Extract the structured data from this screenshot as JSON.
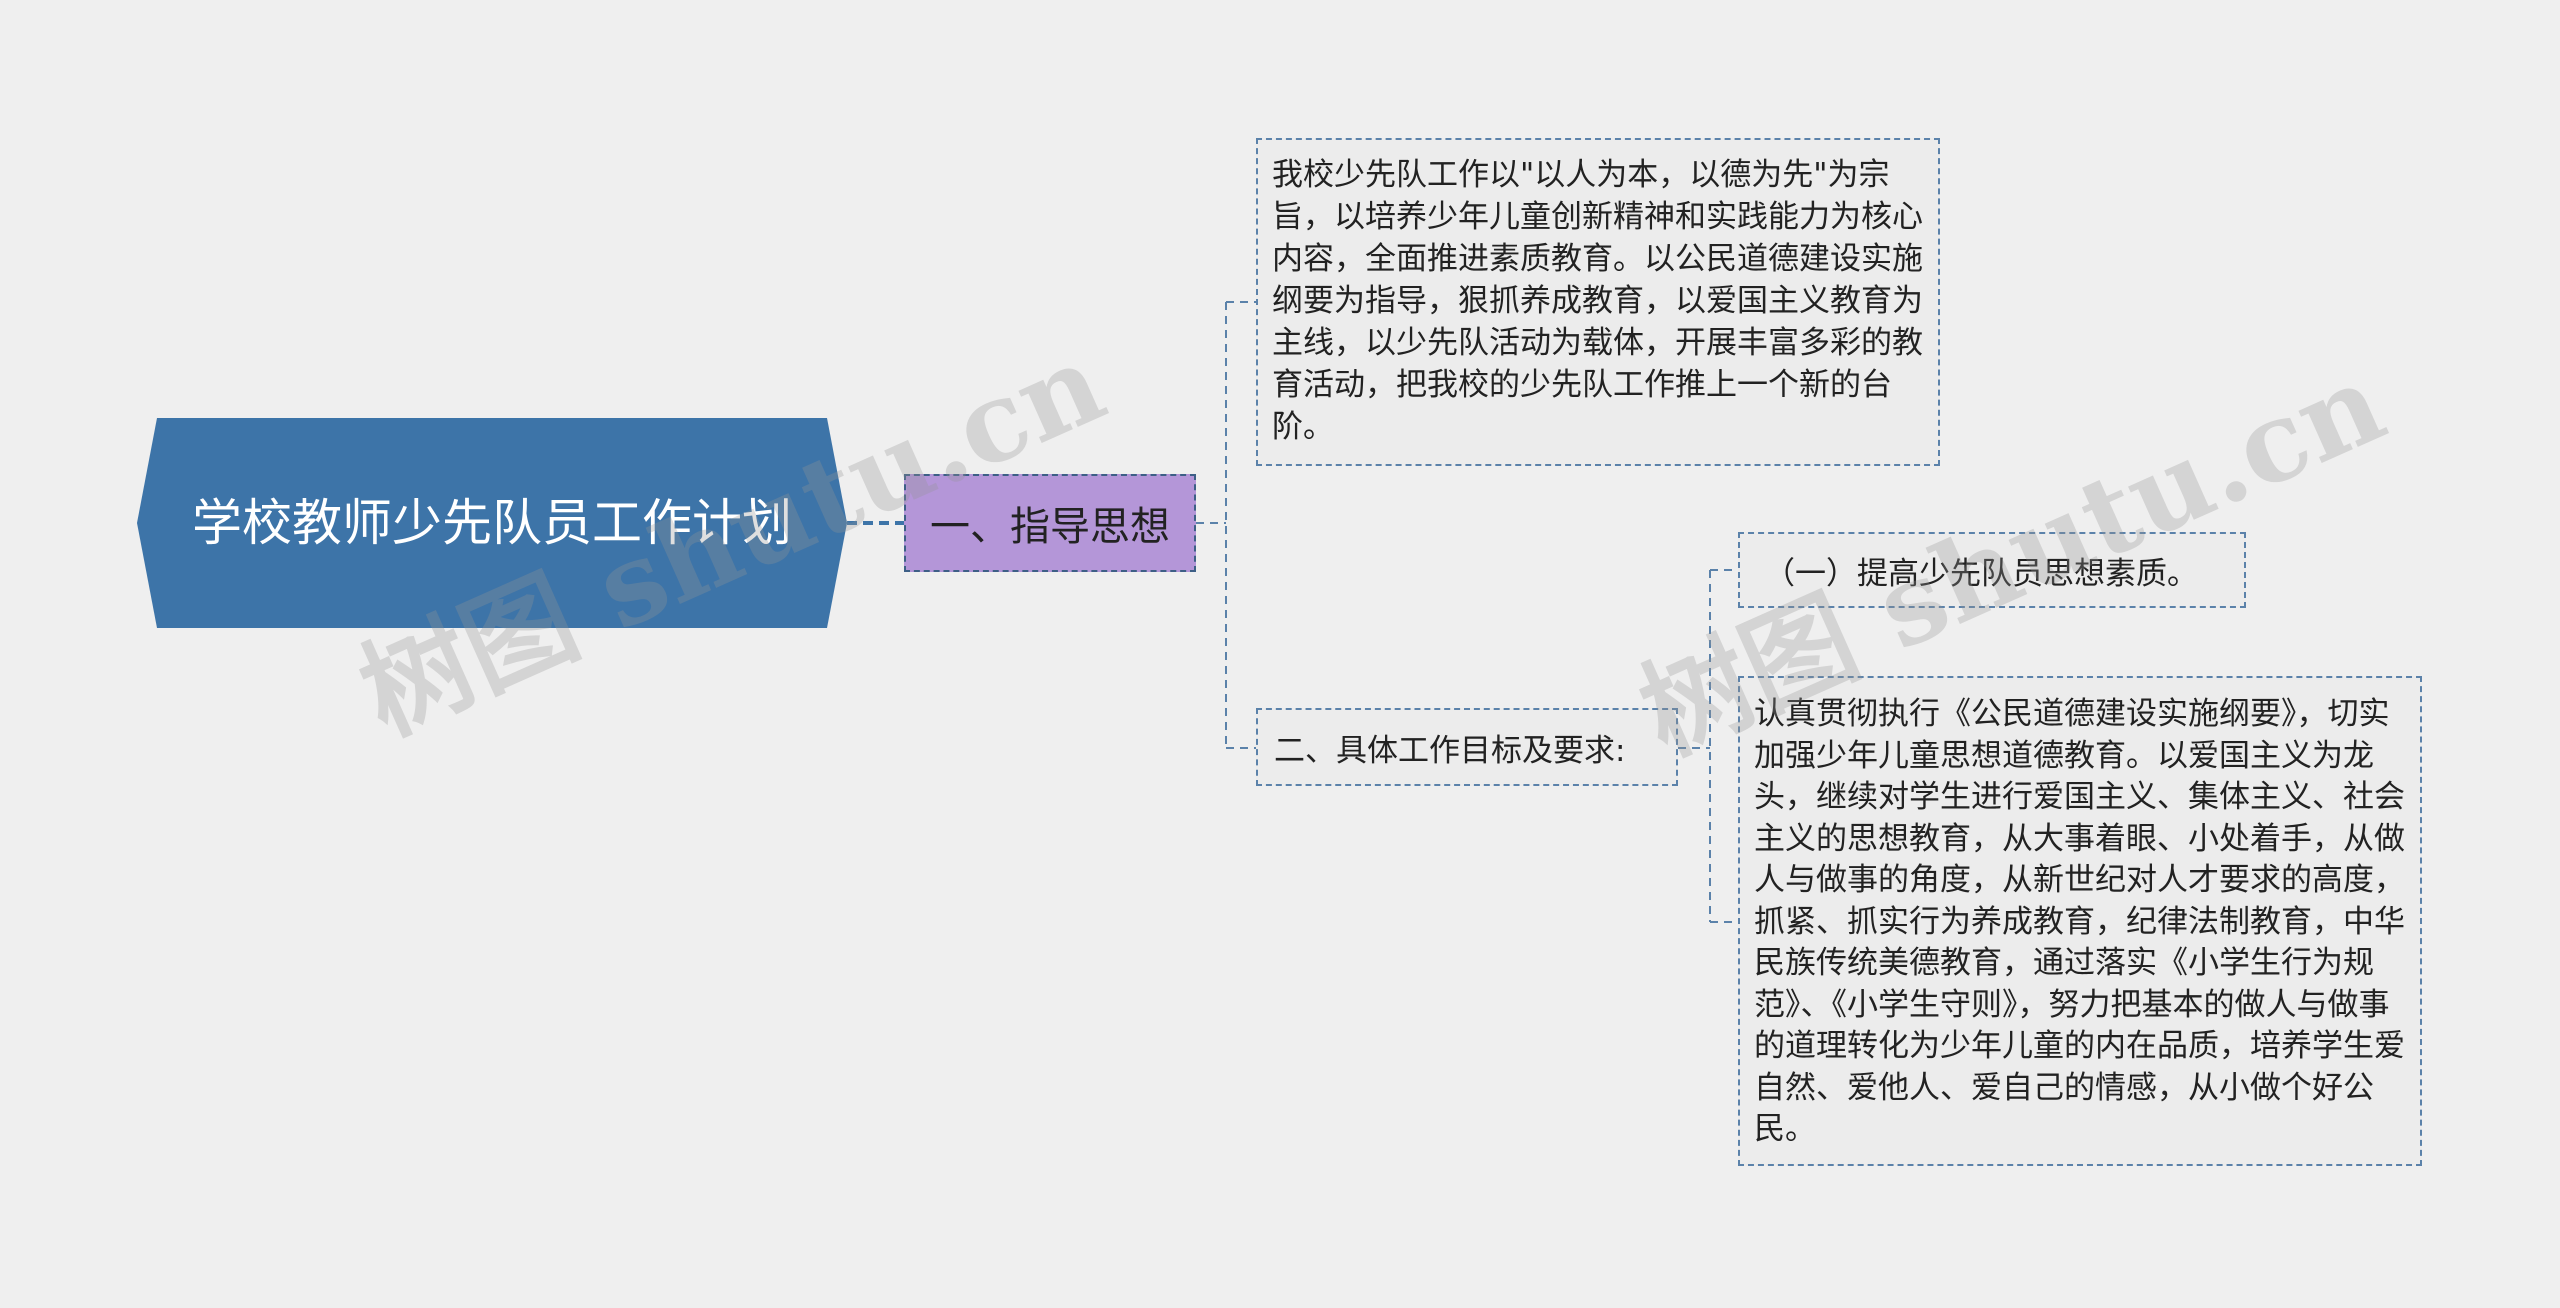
{
  "root": {
    "title": "学校教师少先队员工作计划"
  },
  "nodes": {
    "guiding": {
      "label": "一、指导思想"
    },
    "guiding_text": {
      "text": " 我校少先队工作以\"以人为本，以德为先\"为宗旨，以培养少年儿童创新精神和实践能力为核心内容，全面推进素质教育。以公民道德建设实施纲要为指导，狠抓养成教育，以爱国主义教育为主线，以少先队活动为载体，开展丰富多彩的教育活动，把我校的少先队工作推上一个新的台阶。"
    },
    "goals": {
      "label": "二、具体工作目标及要求:"
    },
    "goal_1": {
      "label": "（一）提高少先队员思想素质。"
    },
    "goal_1_text": {
      "text": " 认真贯彻执行《公民道德建设实施纲要》，切实加强少年儿童思想道德教育。以爱国主义为龙头，继续对学生进行爱国主义、集体主义、社会主义的思想教育，从大事着眼、小处着手，从做人与做事的角度，从新世纪对人才要求的高度，抓紧、抓实行为养成教育，纪律法制教育，中华民族传统美德教育，通过落实《小学生行为规范》、《小学生守则》，努力把基本的做人与做事的道理转化为少年儿童的内在品质，培养学生爱自然、爱他人、爱自己的情感，从小做个好公民。"
    }
  },
  "watermark": "树图 shutu.cn",
  "colors": {
    "root": "#3d74a8",
    "purple": "#b496d8",
    "line": "#5b82aa",
    "background": "#efefef"
  }
}
